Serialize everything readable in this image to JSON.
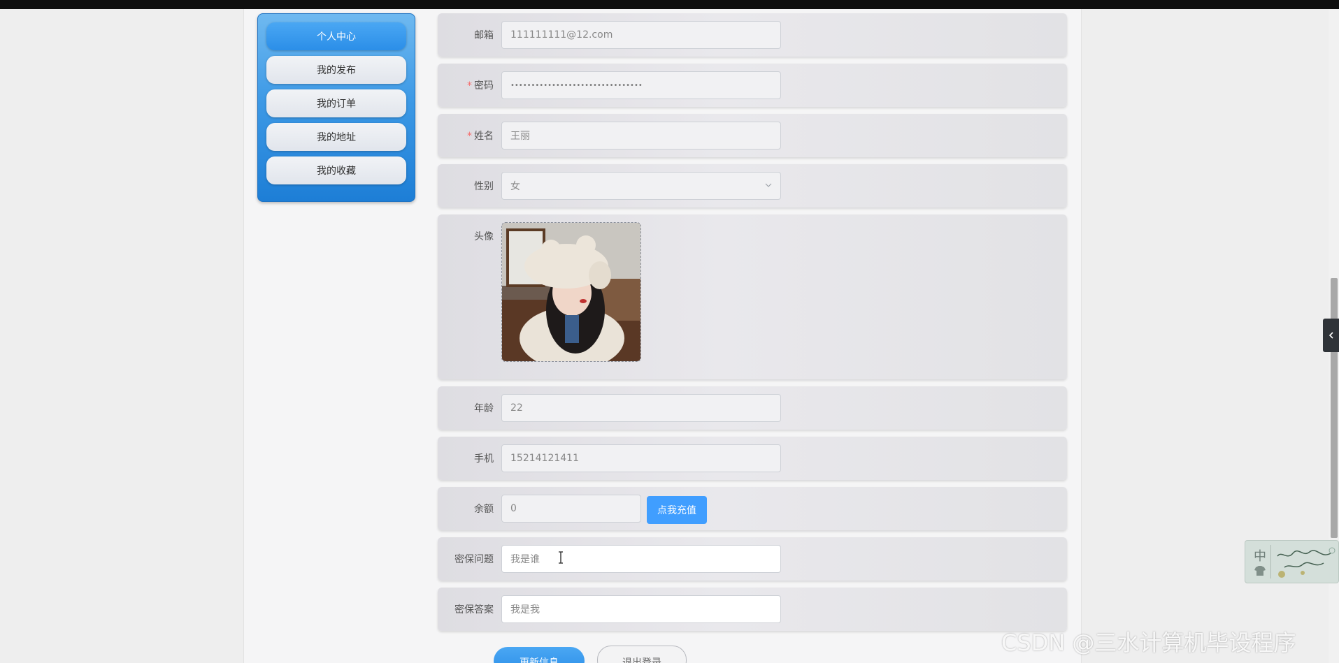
{
  "sidebar": {
    "items": [
      {
        "label": "个人中心",
        "active": true
      },
      {
        "label": "我的发布"
      },
      {
        "label": "我的订单"
      },
      {
        "label": "我的地址"
      },
      {
        "label": "我的收藏"
      }
    ]
  },
  "form": {
    "email": {
      "label": "邮箱",
      "value": "111111111@12.com"
    },
    "password": {
      "label": "密码",
      "required": true,
      "value": "••••••••••••••••••••••••••••••••"
    },
    "name": {
      "label": "姓名",
      "required": true,
      "value": "王丽"
    },
    "gender": {
      "label": "性别",
      "value": "女"
    },
    "avatar": {
      "label": "头像"
    },
    "age": {
      "label": "年龄",
      "value": "22"
    },
    "phone": {
      "label": "手机",
      "value": "15214121411"
    },
    "balance": {
      "label": "余额",
      "value": "0",
      "recharge_label": "点我充值"
    },
    "security_question": {
      "label": "密保问题",
      "value": "我是谁"
    },
    "security_answer": {
      "label": "密保答案",
      "value": "我是我"
    }
  },
  "actions": {
    "update_label": "更新信息",
    "logout_label": "退出登录"
  },
  "ime": {
    "label": "中"
  },
  "watermark": "CSDN @三水计算机毕设程序",
  "colors": {
    "primary": "#409eff",
    "required": "#f56c6c",
    "sidebar_top": "#6fb9f0",
    "sidebar_bottom": "#1d7ed6"
  }
}
